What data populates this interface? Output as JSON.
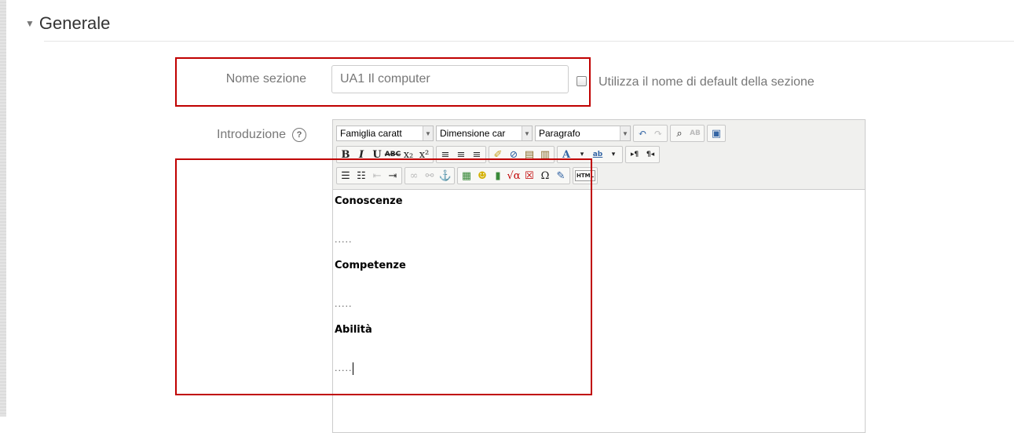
{
  "section": {
    "title": "Generale"
  },
  "form": {
    "name_label": "Nome sezione",
    "name_value": "UA1 Il computer",
    "default_checkbox_label": "Utilizza il nome di default della sezione",
    "intro_label": "Introduzione",
    "help_glyph": "?"
  },
  "editor": {
    "font_family_select": "Famiglia caratt",
    "font_size_select": "Dimensione car",
    "format_select": "Paragrafo",
    "content": [
      {
        "type": "heading",
        "text": "Conoscenze"
      },
      {
        "type": "para",
        "text": "....."
      },
      {
        "type": "heading",
        "text": "Competenze"
      },
      {
        "type": "para",
        "text": "....."
      },
      {
        "type": "heading",
        "text": "Abilità"
      },
      {
        "type": "para",
        "text": "....."
      }
    ]
  },
  "colors": {
    "highlight_box": "#c00000"
  }
}
